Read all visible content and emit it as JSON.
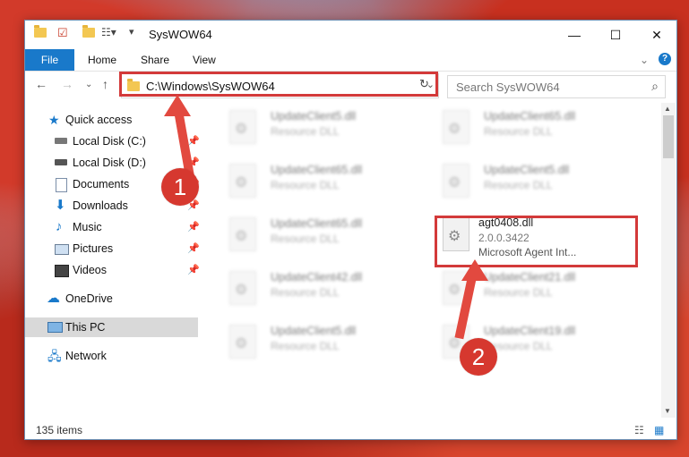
{
  "window": {
    "title": "SysWOW64"
  },
  "ribbon": {
    "tabs": [
      "File",
      "Home",
      "Share",
      "View"
    ]
  },
  "address": {
    "path": "C:\\Windows\\SysWOW64"
  },
  "search": {
    "placeholder": "Search SysWOW64"
  },
  "sidebar": {
    "quick_access": "Quick access",
    "items": [
      {
        "label": "Local Disk (C:)",
        "icon": "drive-icon",
        "pinned": true
      },
      {
        "label": "Local Disk (D:)",
        "icon": "drive-icon",
        "pinned": true
      },
      {
        "label": "Documents",
        "icon": "document-icon",
        "pinned": true
      },
      {
        "label": "Downloads",
        "icon": "download-icon",
        "pinned": true
      },
      {
        "label": "Music",
        "icon": "music-icon",
        "pinned": true
      },
      {
        "label": "Pictures",
        "icon": "picture-icon",
        "pinned": true
      },
      {
        "label": "Videos",
        "icon": "video-icon",
        "pinned": true
      }
    ],
    "onedrive": "OneDrive",
    "this_pc": "This PC",
    "network": "Network"
  },
  "files": [
    {
      "name": "UpdateClient5.dll",
      "desc": "Resource DLL"
    },
    {
      "name": "UpdateClient65.dll",
      "desc": "Resource DLL"
    },
    {
      "name": "UpdateClient65.dll",
      "desc": "Resource DLL"
    },
    {
      "name": "UpdateClient5.dll",
      "desc": "Resource DLL"
    },
    {
      "name": "UpdateClient65.dll",
      "desc": "Resource DLL"
    },
    {
      "name": "agt0408.dll",
      "version": "2.0.0.3422",
      "desc": "Microsoft Agent Int..."
    },
    {
      "name": "UpdateClient42.dll",
      "desc": "Resource DLL"
    },
    {
      "name": "UpdateClient21.dll",
      "desc": "Resource DLL"
    },
    {
      "name": "UpdateClient5.dll",
      "desc": "Resource DLL"
    },
    {
      "name": "UpdateClient19.dll",
      "desc": "Resource DLL"
    }
  ],
  "status": {
    "count": "135 items"
  },
  "annotations": {
    "step1": "1",
    "step2": "2"
  },
  "colors": {
    "accent": "#1979ca",
    "highlight": "#d33a3a"
  }
}
